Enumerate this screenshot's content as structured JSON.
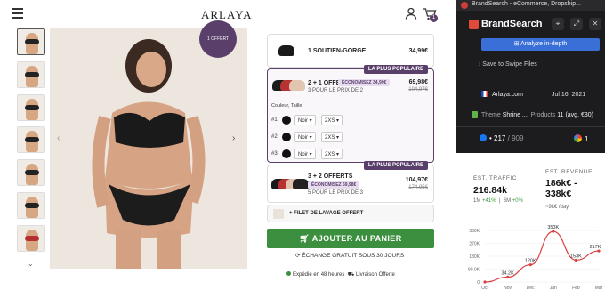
{
  "header": {
    "logo": "ARLAYA",
    "cart_count": "1"
  },
  "gallery": {
    "badge": "1 OFFERT"
  },
  "options": [
    {
      "title": "1 SOUTIEN-GORGE",
      "price": "34,99€"
    },
    {
      "tag": "LA PLUS POPULAIRE",
      "title": "2 + 1 OFFERT",
      "subtitle": "3 POUR LE PRIX DE 2",
      "save": "ÉCONOMISEZ 34,99€",
      "price": "69,98€",
      "old_price": "104,97€",
      "variant_label": "Couleur, Taille",
      "rows": [
        {
          "num": "#1",
          "color": "Noir",
          "size": "2XS"
        },
        {
          "num": "#2",
          "color": "Noir",
          "size": "2XS"
        },
        {
          "num": "#3",
          "color": "Noir",
          "size": "2XS"
        }
      ]
    },
    {
      "tag": "LA PLUS POPULAIRE",
      "title": "3 + 2 OFFERTS",
      "subtitle": "5 POUR LE PRIX DE 3",
      "save": "ÉCONOMISEZ 69,98€",
      "price": "104,97€",
      "old_price": "174,95€"
    }
  ],
  "gift": {
    "label": "+ FILET DE LAVAGE OFFERT"
  },
  "cta": {
    "add_to_cart": "AJOUTER AU PANIER",
    "exchange": "ÉCHANGE GRATUIT SOUS 30 JOURS",
    "shipping": "Expédié en 48 heures",
    "delivery": "Livraison Offerte"
  },
  "extension": {
    "tab_title": "BrandSearch - eCommerce, Dropship...",
    "title": "BrandSearch",
    "analyze_button": "Analyze in-depth",
    "swipe": "Save to Swipe Files",
    "domain": "Arlaya.com",
    "date": "Jul 16, 2021",
    "theme_label": "Theme",
    "theme_value": "Shrine ...",
    "products_label": "Products",
    "products_value": "11 (avg. €30)",
    "fb_ads": "217",
    "fb_total": "/ 909",
    "google": "1",
    "traffic_label": "EST. TRAFFIC",
    "traffic_value": "216.84k",
    "traffic_1m_label": "1M",
    "traffic_1m": "+41%",
    "traffic_6m_label": "6M",
    "traffic_6m": "+0%",
    "revenue_label": "EST. REVENUE",
    "revenue_value": "186k€ - 338k€",
    "revenue_sub": "~9k€ /day"
  },
  "chart_data": {
    "type": "line",
    "categories": [
      "Oct",
      "Nov",
      "Dec",
      "Jan",
      "Feb",
      "Mar"
    ],
    "values": [
      0,
      34200,
      120000,
      353000,
      153000,
      217000
    ],
    "data_labels": [
      "",
      "34.2K",
      "120K",
      "353K",
      "153K",
      "217K"
    ],
    "y_ticks": [
      "0",
      "90.0K",
      "180K",
      "270K",
      "360K"
    ],
    "ylim": [
      0,
      360000
    ],
    "color": "#d94040"
  }
}
